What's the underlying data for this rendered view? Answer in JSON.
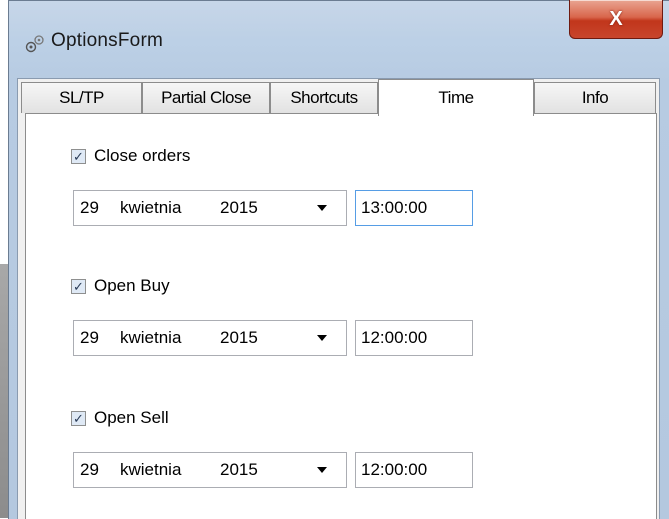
{
  "window": {
    "title": "OptionsForm",
    "close_label": "X"
  },
  "tabs": [
    {
      "label": "SL/TP",
      "active": false
    },
    {
      "label": "Partial Close",
      "active": false
    },
    {
      "label": "Shortcuts",
      "active": false
    },
    {
      "label": "Time",
      "active": true
    },
    {
      "label": "Info",
      "active": false
    }
  ],
  "time_tab": {
    "groups": [
      {
        "checkbox_label": "Close orders",
        "checked": true,
        "day": "29",
        "month": "kwietnia",
        "year": "2015",
        "time": "13:00:00"
      },
      {
        "checkbox_label": "Open Buy",
        "checked": true,
        "day": "29",
        "month": "kwietnia",
        "year": "2015",
        "time": "12:00:00"
      },
      {
        "checkbox_label": "Open Sell",
        "checked": true,
        "day": "29",
        "month": "kwietnia",
        "year": "2015",
        "time": "12:00:00"
      }
    ]
  }
}
